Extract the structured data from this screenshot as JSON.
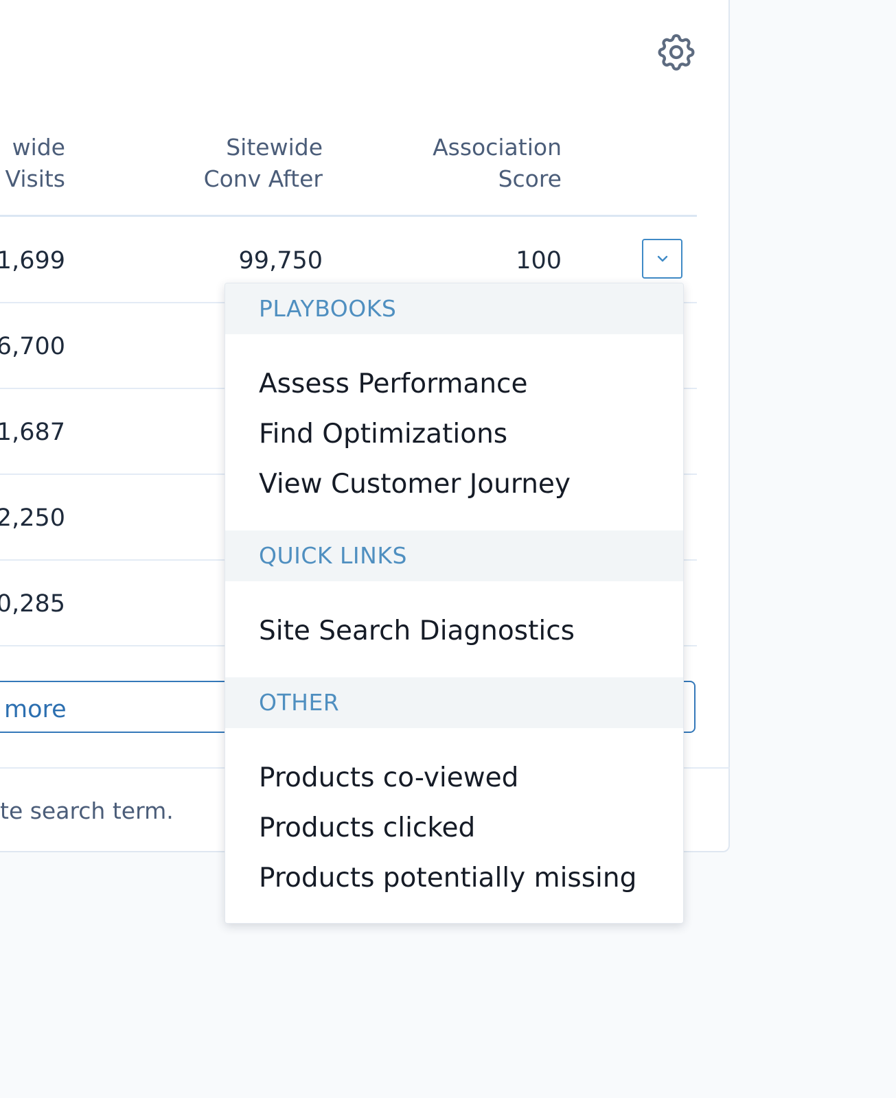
{
  "settings": {
    "icon": "gear-icon"
  },
  "table": {
    "headers": [
      {
        "line1": "wide",
        "line2": "Visits"
      },
      {
        "line1": "Sitewide",
        "line2": "Conv After"
      },
      {
        "line1": "Association",
        "line2": "Score"
      }
    ],
    "rows": [
      {
        "visits": "1,699",
        "conv_after": "99,750",
        "score": "100"
      },
      {
        "visits": "6,700"
      },
      {
        "visits": "1,687"
      },
      {
        "visits": "2,250"
      },
      {
        "visits": "0,285"
      }
    ],
    "row_toggle_icon": "chevron-down-icon"
  },
  "show_more": {
    "label": "more"
  },
  "footnote": "te search term.",
  "menu": {
    "sections": [
      {
        "title": "PLAYBOOKS",
        "items": [
          "Assess Performance",
          "Find Optimizations",
          "View Customer Journey"
        ]
      },
      {
        "title": "QUICK LINKS",
        "items": [
          "Site Search Diagnostics"
        ]
      },
      {
        "title": "OTHER",
        "items": [
          "Products co-viewed",
          "Products clicked",
          "Products potentially missing"
        ]
      }
    ]
  },
  "colors": {
    "accent": "#3478b9",
    "section_header_text": "#4f8fc0",
    "section_header_bg": "#f2f5f7"
  }
}
